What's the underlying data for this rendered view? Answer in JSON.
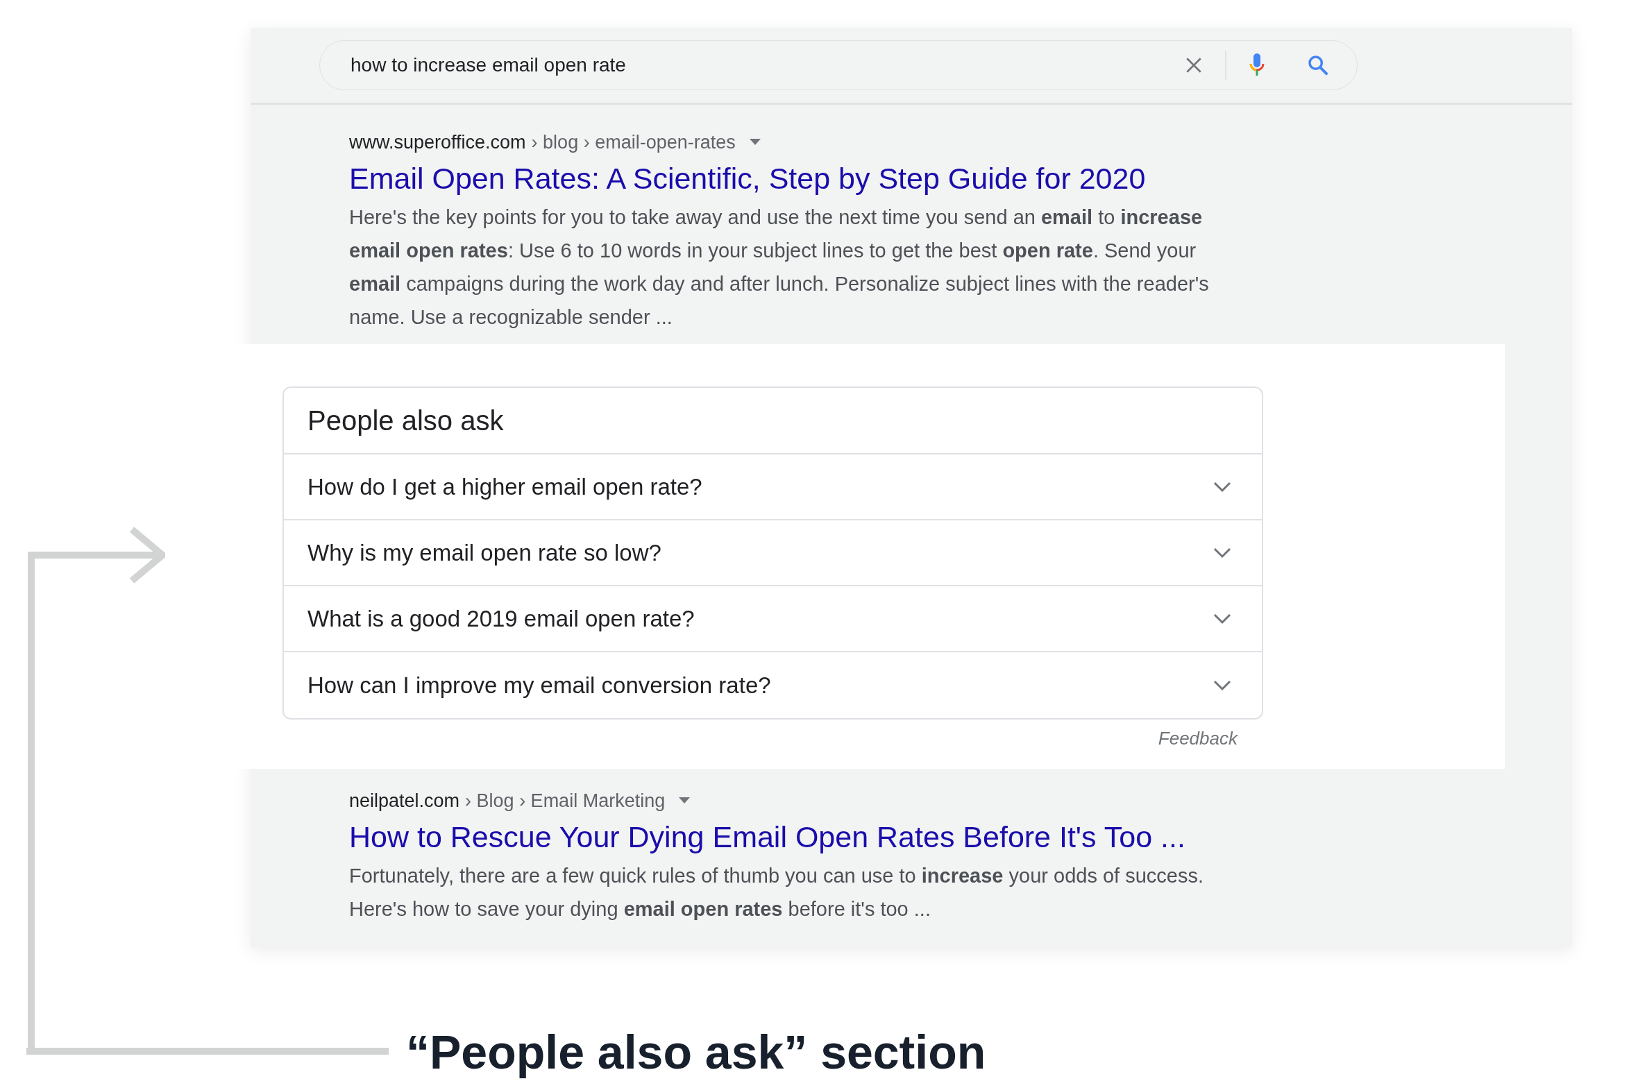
{
  "search": {
    "value": "how to increase email open rate"
  },
  "results": [
    {
      "domain": "www.superoffice.com",
      "path": "› blog › email-open-rates",
      "title": "Email Open Rates: A Scientific, Step by Step Guide for 2020",
      "snippet": "Here's the key points for you to take away and use the next time you send an **email** to **increase email open rates**: Use 6 to 10 words in your subject lines to get the best **open rate**. Send your **email** campaigns during the work day and after lunch. Personalize subject lines with the reader's name. Use a recognizable sender ..."
    },
    {
      "domain": "neilpatel.com",
      "path": "› Blog › Email Marketing",
      "title": "How to Rescue Your Dying Email Open Rates Before It's Too ...",
      "snippet": "Fortunately, there are a few quick rules of thumb you can use to **increase** your odds of success. Here's how to save your dying **email open rates** before it's too ..."
    }
  ],
  "people_also_ask": {
    "title": "People also ask",
    "questions": [
      {
        "text": "How do I get a higher email open rate?",
        "expanded": false
      },
      {
        "text": "Why is my email open rate so low?",
        "expanded": false
      },
      {
        "text": "What is a good 2019 email open rate?",
        "expanded": false
      },
      {
        "text": "How can I improve my email conversion rate?",
        "expanded": false
      }
    ],
    "feedback": "Feedback"
  },
  "caption": "“People also ask” section"
}
